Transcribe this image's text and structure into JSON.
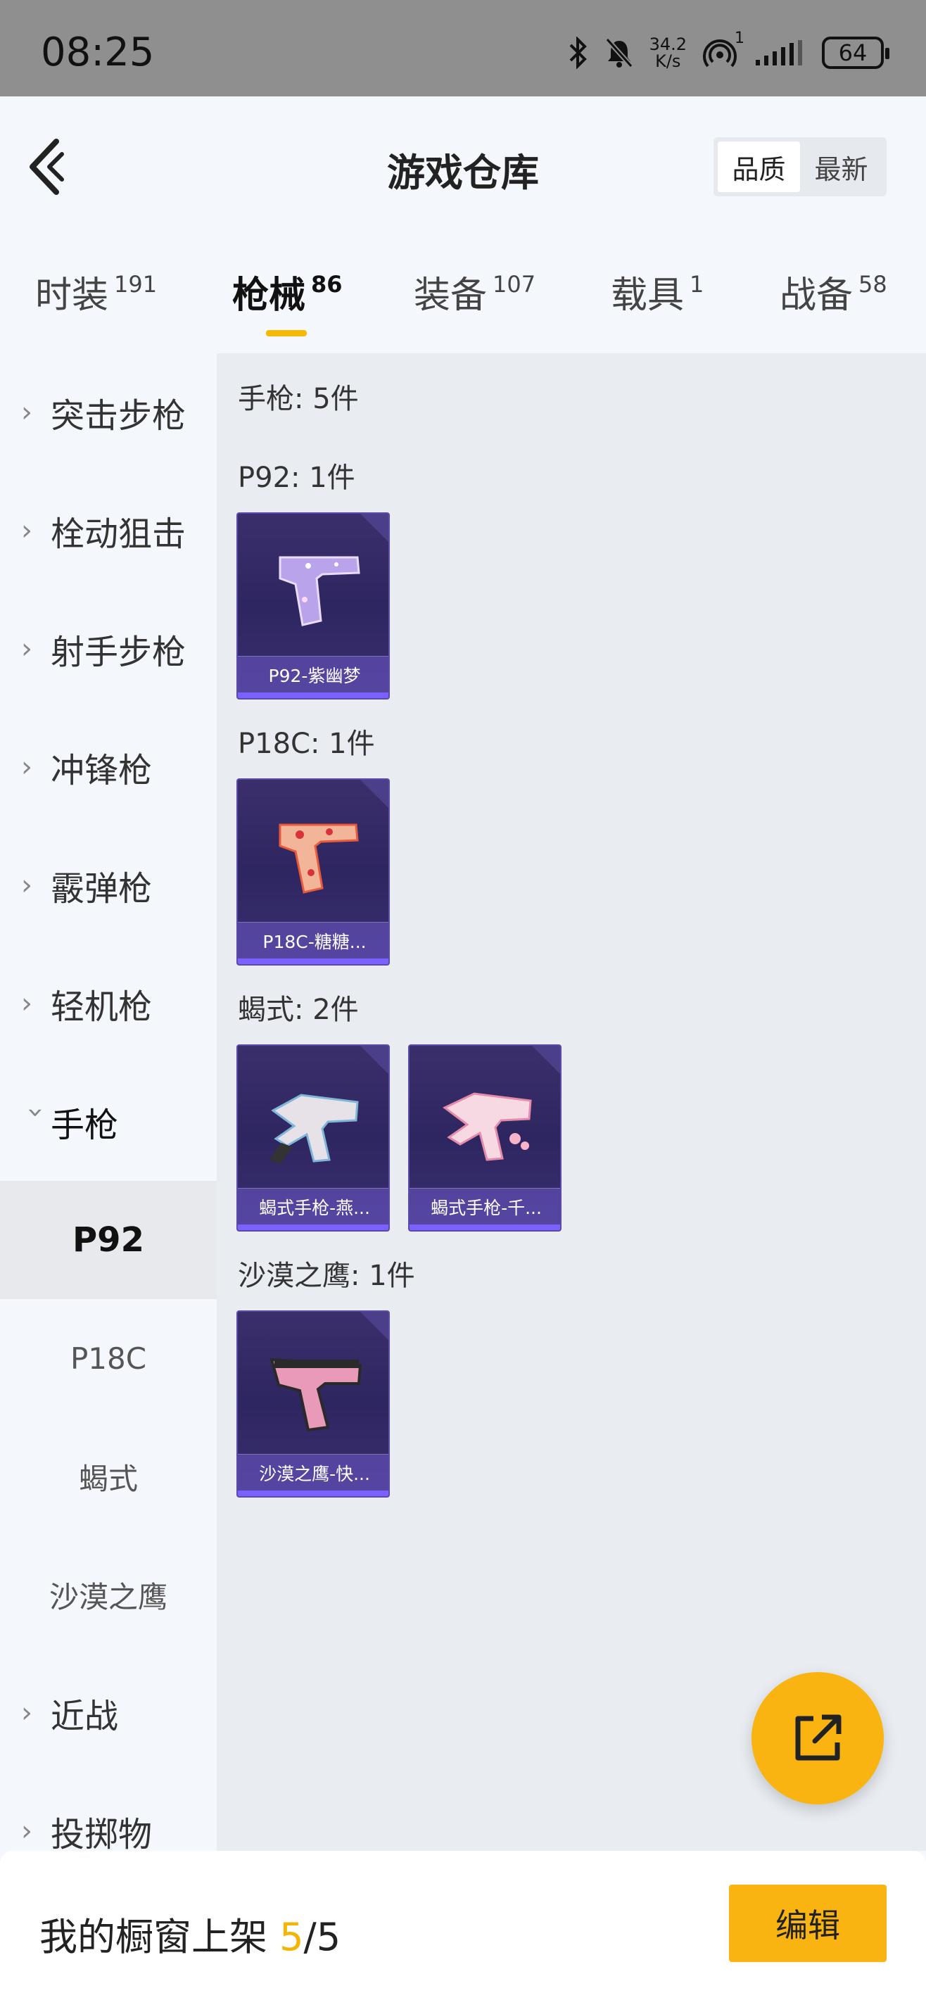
{
  "status": {
    "time": "08:25",
    "net_speed_value": "34.2",
    "net_speed_unit": "K/s",
    "hotspot_count": "1",
    "battery": "64"
  },
  "header": {
    "title": "游戏仓库",
    "sort_options": [
      "品质",
      "最新"
    ],
    "sort_selected": "品质"
  },
  "tabs": [
    {
      "label": "时装",
      "count": "191"
    },
    {
      "label": "枪械",
      "count": "86"
    },
    {
      "label": "装备",
      "count": "107"
    },
    {
      "label": "载具",
      "count": "1"
    },
    {
      "label": "战备",
      "count": "58"
    }
  ],
  "active_tab": "枪械",
  "sidebar": {
    "categories": [
      "突击步枪",
      "栓动狙击",
      "射手步枪",
      "冲锋枪",
      "霰弹枪",
      "轻机枪",
      "手枪"
    ],
    "expanded": "手枪",
    "subitems": [
      "P92",
      "P18C",
      "蝎式",
      "沙漠之鹰"
    ],
    "selected_sub": "P92",
    "more_categories": [
      "近战",
      "投掷物"
    ]
  },
  "content": {
    "section_summary": "手枪: 5件",
    "groups": [
      {
        "label": "P92: 1件",
        "items": [
          "P92-紫幽梦"
        ]
      },
      {
        "label": "P18C: 1件",
        "items": [
          "P18C-糖糖..."
        ]
      },
      {
        "label": "蝎式: 2件",
        "items": [
          "蝎式手枪-燕...",
          "蝎式手枪-千..."
        ]
      },
      {
        "label": "沙漠之鹰: 1件",
        "items": [
          "沙漠之鹰-快..."
        ]
      }
    ]
  },
  "footer": {
    "label": "我的橱窗上架",
    "current": "5",
    "sep": "/",
    "total": "5",
    "edit_label": "编辑"
  },
  "colors": {
    "accent": "#f9b411",
    "card_bg": "#2e2660",
    "card_bar": "#7b61ff"
  }
}
